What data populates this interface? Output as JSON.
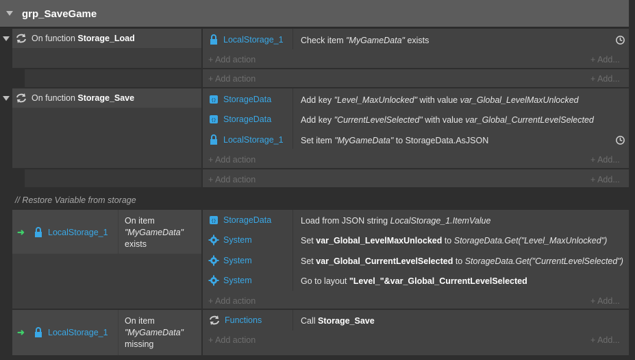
{
  "group": {
    "title": "grp_SaveGame"
  },
  "events": [
    {
      "condition_prefix": "On function ",
      "condition_name": "Storage_Load",
      "actions": [
        {
          "object": "LocalStorage_1",
          "text": "Check item \"MyGameData\" exists"
        }
      ]
    },
    {
      "condition_prefix": "On function ",
      "condition_name": "Storage_Save",
      "actions": [
        {
          "object": "StorageData",
          "pre": "Add key ",
          "key": "\"Level_MaxUnlocked\"",
          "mid": " with value ",
          "val": "var_Global_LevelMaxUnlocked"
        },
        {
          "object": "StorageData",
          "pre": "Add key ",
          "key": "\"CurrentLevelSelected\"",
          "mid": " with value ",
          "val": "var_Global_CurrentLevelSelected"
        },
        {
          "object": "LocalStorage_1",
          "pre": "Set item ",
          "key": "\"MyGameData\"",
          "post": " to StorageData.AsJSON"
        }
      ]
    },
    {
      "trigger_object": "LocalStorage_1",
      "trigger_lines": [
        "On item",
        "\"MyGameData\"",
        "exists"
      ],
      "actions": [
        {
          "object": "StorageData",
          "pre": "Load from JSON string ",
          "val": "LocalStorage_1.ItemValue"
        },
        {
          "object": "System",
          "pre": "Set ",
          "var": "var_Global_LevelMaxUnlocked",
          "mid": " to ",
          "val": "StorageData.Get(\"Level_MaxUnlocked\")"
        },
        {
          "object": "System",
          "pre": "Set ",
          "var": "var_Global_CurrentLevelSelected",
          "mid": " to ",
          "val": "StorageData.Get(\"CurrentLevelSelected\")"
        },
        {
          "object": "System",
          "pre": "Go to layout ",
          "var": "\"Level_\"&var_Global_CurrentLevelSelected"
        }
      ]
    },
    {
      "trigger_object": "LocalStorage_1",
      "trigger_lines": [
        "On item",
        "\"MyGameData\"",
        "missing"
      ],
      "actions": [
        {
          "object": "Functions",
          "pre": "Call ",
          "var": "Storage_Save"
        }
      ]
    }
  ],
  "comment": "// Restore Variable from storage",
  "labels": {
    "add_action": "+ Add action",
    "add_right": "+ Add..."
  }
}
